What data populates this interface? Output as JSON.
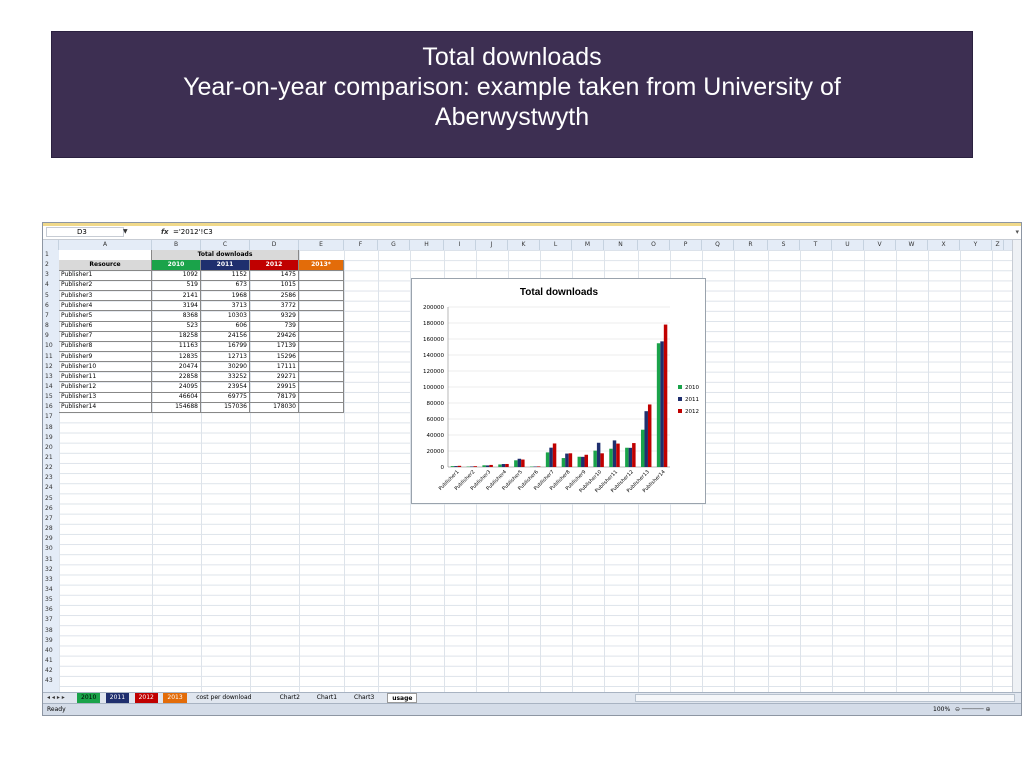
{
  "slide": {
    "title_line1": "Total downloads",
    "title_line2": "Year-on-year comparison: example taken from University of",
    "title_line3": "Aberwystwyth"
  },
  "formula_bar": {
    "name_box": "D3",
    "fx": "fx",
    "formula": "='2012'!C3"
  },
  "columns": [
    "A",
    "B",
    "C",
    "D",
    "E",
    "F",
    "G",
    "H",
    "I",
    "J",
    "K",
    "L",
    "M",
    "N",
    "O",
    "P",
    "Q",
    "R",
    "S",
    "T",
    "U",
    "V",
    "W",
    "X",
    "Y",
    "Z"
  ],
  "rows": [
    "1",
    "2",
    "3",
    "4",
    "5",
    "6",
    "7",
    "8",
    "9",
    "10",
    "11",
    "12",
    "13",
    "14",
    "15",
    "16",
    "17",
    "18",
    "19",
    "20",
    "21",
    "22",
    "23",
    "24",
    "25",
    "26",
    "27",
    "28",
    "29",
    "30",
    "31",
    "32",
    "33",
    "34",
    "35",
    "36",
    "37",
    "38",
    "39",
    "40",
    "41",
    "42",
    "43"
  ],
  "table": {
    "title": "Total downloads",
    "resource_header": "Resource",
    "year_headers": [
      "2010",
      "2011",
      "2012",
      "2013*"
    ],
    "year_colors": [
      "#1aa34a",
      "#1f2f6e",
      "#c00000",
      "#e36c09"
    ],
    "rows": [
      {
        "name": "Publisher1",
        "v2010": "1092",
        "v2011": "1152",
        "v2012": "1475"
      },
      {
        "name": "Publisher2",
        "v2010": "519",
        "v2011": "673",
        "v2012": "1015"
      },
      {
        "name": "Publisher3",
        "v2010": "2141",
        "v2011": "1968",
        "v2012": "2586"
      },
      {
        "name": "Publisher4",
        "v2010": "3194",
        "v2011": "3713",
        "v2012": "3772"
      },
      {
        "name": "Publisher5",
        "v2010": "8368",
        "v2011": "10303",
        "v2012": "9329"
      },
      {
        "name": "Publisher6",
        "v2010": "523",
        "v2011": "606",
        "v2012": "739"
      },
      {
        "name": "Publisher7",
        "v2010": "18258",
        "v2011": "24156",
        "v2012": "29426"
      },
      {
        "name": "Publisher8",
        "v2010": "11163",
        "v2011": "16799",
        "v2012": "17139"
      },
      {
        "name": "Publisher9",
        "v2010": "12835",
        "v2011": "12713",
        "v2012": "15296"
      },
      {
        "name": "Publisher10",
        "v2010": "20474",
        "v2011": "30290",
        "v2012": "17111"
      },
      {
        "name": "Publisher11",
        "v2010": "22858",
        "v2011": "33252",
        "v2012": "29271"
      },
      {
        "name": "Publisher12",
        "v2010": "24095",
        "v2011": "23954",
        "v2012": "29915"
      },
      {
        "name": "Publisher13",
        "v2010": "46604",
        "v2011": "69775",
        "v2012": "78179"
      },
      {
        "name": "Publisher14",
        "v2010": "154688",
        "v2011": "157036",
        "v2012": "178030"
      }
    ]
  },
  "chart_data": {
    "type": "bar",
    "title": "Total downloads",
    "categories": [
      "Publisher1",
      "Publisher2",
      "Publisher3",
      "Publisher4",
      "Publisher5",
      "Publisher6",
      "Publisher7",
      "Publisher8",
      "Publisher9",
      "Publisher10",
      "Publisher11",
      "Publisher12",
      "Publisher13",
      "Publisher14"
    ],
    "series": [
      {
        "name": "2010",
        "color": "#1aa34a",
        "values": [
          1092,
          519,
          2141,
          3194,
          8368,
          523,
          18258,
          11163,
          12835,
          20474,
          22858,
          24095,
          46604,
          154688
        ]
      },
      {
        "name": "2011",
        "color": "#1f2f6e",
        "values": [
          1152,
          673,
          1968,
          3713,
          10303,
          606,
          24156,
          16799,
          12713,
          30290,
          33252,
          23954,
          69775,
          157036
        ]
      },
      {
        "name": "2012",
        "color": "#c00000",
        "values": [
          1475,
          1015,
          2586,
          3772,
          9329,
          739,
          29426,
          17139,
          15296,
          17111,
          29271,
          29915,
          78179,
          178030
        ]
      }
    ],
    "ylim": [
      0,
      200000
    ],
    "yticks": [
      0,
      20000,
      40000,
      60000,
      80000,
      100000,
      120000,
      140000,
      160000,
      180000,
      200000
    ],
    "ytick_labels": [
      "0",
      "20000",
      "40000",
      "60000",
      "80000",
      "100000",
      "120000",
      "140000",
      "160000",
      "180000",
      "200000"
    ],
    "grid": true,
    "legend": "right"
  },
  "sheet_tabs": [
    {
      "label": "2010",
      "color": "#1aa34a",
      "text": "#000000"
    },
    {
      "label": "2011",
      "color": "#1f2f6e",
      "text": "#ffffff"
    },
    {
      "label": "2012",
      "color": "#c00000",
      "text": "#ffffff"
    },
    {
      "label": "2013",
      "color": "#e36c09",
      "text": "#ffffff"
    },
    {
      "label": "cost per download",
      "color": "",
      "text": "#000000"
    },
    {
      "label": "Chart2",
      "color": "",
      "text": "#000000"
    },
    {
      "label": "Chart1",
      "color": "",
      "text": "#000000"
    },
    {
      "label": "Chart3",
      "color": "",
      "text": "#000000"
    },
    {
      "label": "usage",
      "color": "#ffffff",
      "text": "#000000"
    }
  ],
  "status": {
    "text": "Ready",
    "zoom": "100%"
  }
}
